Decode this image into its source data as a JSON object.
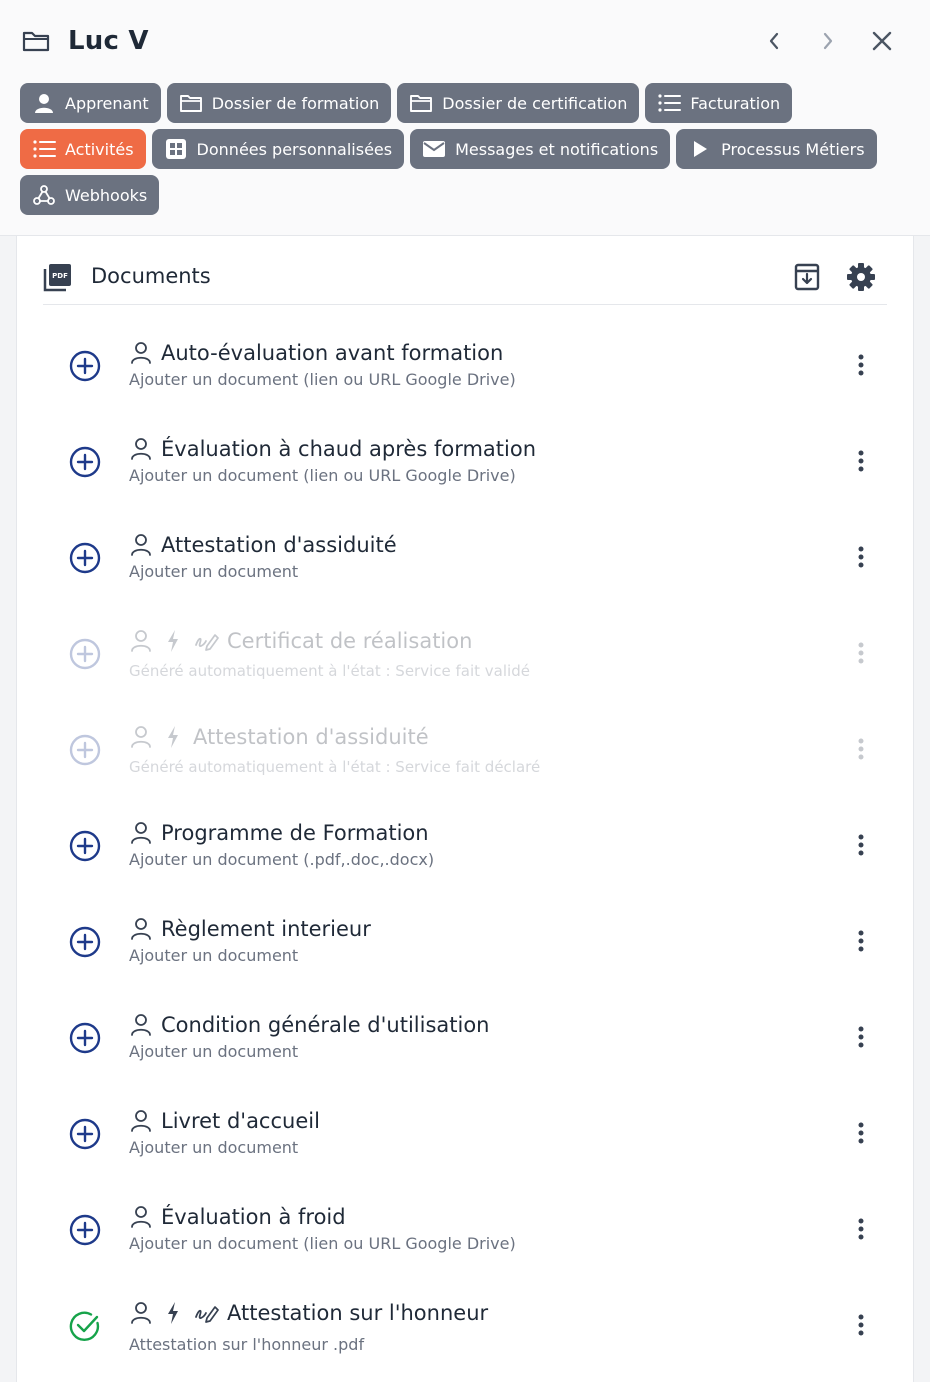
{
  "header": {
    "title": "Luc V",
    "icons": {
      "title": "folder-icon",
      "prev": "chevron-left-icon",
      "next": "chevron-right-icon",
      "close": "close-icon"
    }
  },
  "tabs": [
    {
      "label": "Apprenant",
      "icon": "user-icon",
      "active": false
    },
    {
      "label": "Dossier de formation",
      "icon": "folder-icon",
      "active": false
    },
    {
      "label": "Dossier de certification",
      "icon": "folder-icon",
      "active": false
    },
    {
      "label": "Facturation",
      "icon": "list-icon",
      "active": false
    },
    {
      "label": "Activités",
      "icon": "list-icon",
      "active": true
    },
    {
      "label": "Données personnalisées",
      "icon": "grid-icon",
      "active": false
    },
    {
      "label": "Messages et notifications",
      "icon": "mail-icon",
      "active": false
    },
    {
      "label": "Processus Métiers",
      "icon": "play-icon",
      "active": false
    },
    {
      "label": "Webhooks",
      "icon": "webhook-icon",
      "active": false
    }
  ],
  "documents": {
    "title": "Documents",
    "icons": {
      "section": "pdf-icon",
      "archive": "archive-download-icon",
      "settings": "gear-icon"
    },
    "items": [
      {
        "title": "Auto-évaluation avant formation",
        "subtitle": "Ajouter un document (lien ou URL Google Drive)",
        "state": "add"
      },
      {
        "title": "Évaluation à chaud après formation",
        "subtitle": "Ajouter un document (lien ou URL Google Drive)",
        "state": "add"
      },
      {
        "title": "Attestation d'assiduité",
        "subtitle": "Ajouter un document",
        "state": "add"
      },
      {
        "title": "Certificat de réalisation",
        "subtitle": "Généré automatiquement à l'état : Service fait validé",
        "state": "disabled",
        "auto": true,
        "signature": true
      },
      {
        "title": "Attestation d'assiduité",
        "subtitle": "Généré automatiquement à l'état : Service fait déclaré",
        "state": "disabled",
        "auto": true,
        "signature": false
      },
      {
        "title": "Programme de Formation",
        "subtitle": "Ajouter un document (.pdf,.doc,.docx)",
        "state": "add"
      },
      {
        "title": "Règlement interieur",
        "subtitle": "Ajouter un document",
        "state": "add"
      },
      {
        "title": "Condition générale d'utilisation",
        "subtitle": "Ajouter un document",
        "state": "add"
      },
      {
        "title": "Livret d'accueil",
        "subtitle": "Ajouter un document",
        "state": "add"
      },
      {
        "title": "Évaluation à froid",
        "subtitle": "Ajouter un document (lien ou URL Google Drive)",
        "state": "add"
      },
      {
        "title": "Attestation sur l'honneur",
        "subtitle": "Attestation sur l'honneur .pdf",
        "state": "done",
        "auto": true,
        "signature": true
      }
    ]
  },
  "colors": {
    "tab": "#6b7280",
    "tab_active": "#ef6b45",
    "add_icon": "#1e3a8a",
    "done_icon": "#16a34a",
    "text_muted": "#6b7280"
  }
}
